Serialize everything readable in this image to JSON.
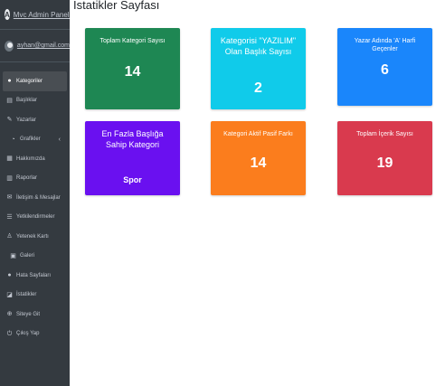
{
  "brand": {
    "logo_letter": "A",
    "title": "Mvc Admin Paneli"
  },
  "user": {
    "email": "ayhan@gmail.com"
  },
  "nav": [
    {
      "label": "Kategoriler",
      "icon": "tag-icon",
      "glyph": "●"
    },
    {
      "label": "Başlıklar",
      "icon": "book-icon",
      "glyph": "▤"
    },
    {
      "label": "Yazarlar",
      "icon": "pen-icon",
      "glyph": "✎"
    },
    {
      "label": "Grafikler",
      "icon": "chart-icon",
      "glyph": "◔"
    },
    {
      "label": "Hakkımızda",
      "icon": "address-card-icon",
      "glyph": "▦"
    },
    {
      "label": "Raporlar",
      "icon": "file-icon",
      "glyph": "▥"
    },
    {
      "label": "İletişim & Mesajlar",
      "icon": "envelope-icon",
      "glyph": "✉"
    },
    {
      "label": "Yetkilendirmeler",
      "icon": "users-icon",
      "glyph": "☰"
    },
    {
      "label": "Yetenek Kartı",
      "icon": "user-icon",
      "glyph": "♙"
    },
    {
      "label": "Galeri",
      "icon": "image-icon",
      "glyph": "▣"
    },
    {
      "label": "Hata Sayfaları",
      "icon": "warning-icon",
      "glyph": "●"
    },
    {
      "label": "İstatikler",
      "icon": "stats-icon",
      "glyph": "◪"
    },
    {
      "label": "Siteye Git",
      "icon": "globe-icon",
      "glyph": "⊕"
    },
    {
      "label": "Çıkış Yap",
      "icon": "power-icon",
      "glyph": "⏻"
    }
  ],
  "grafikler_chevron": "‹",
  "page_title": "İstatikler Sayfası",
  "cards": [
    {
      "label": "Toplam Kategori Sayısı",
      "value": "14",
      "color": "#1e8753"
    },
    {
      "label": "Kategorisi \"YAZILIM\" Olan Başlık Sayısı",
      "value": "2",
      "color": "#10cbea"
    },
    {
      "label": "Yazar Adında 'A' Harfi Geçenler",
      "value": "6",
      "color": "#1a86fb"
    },
    {
      "label": "En Fazla Başlığa Sahip Kategori",
      "value": "Spor",
      "color": "#6a10f0"
    },
    {
      "label": "Kategori Aktif Pasif Farkı",
      "value": "14",
      "color": "#fb7d1d"
    },
    {
      "label": "Toplam İçerik Sayısı",
      "value": "19",
      "color": "#d93a4e"
    }
  ]
}
